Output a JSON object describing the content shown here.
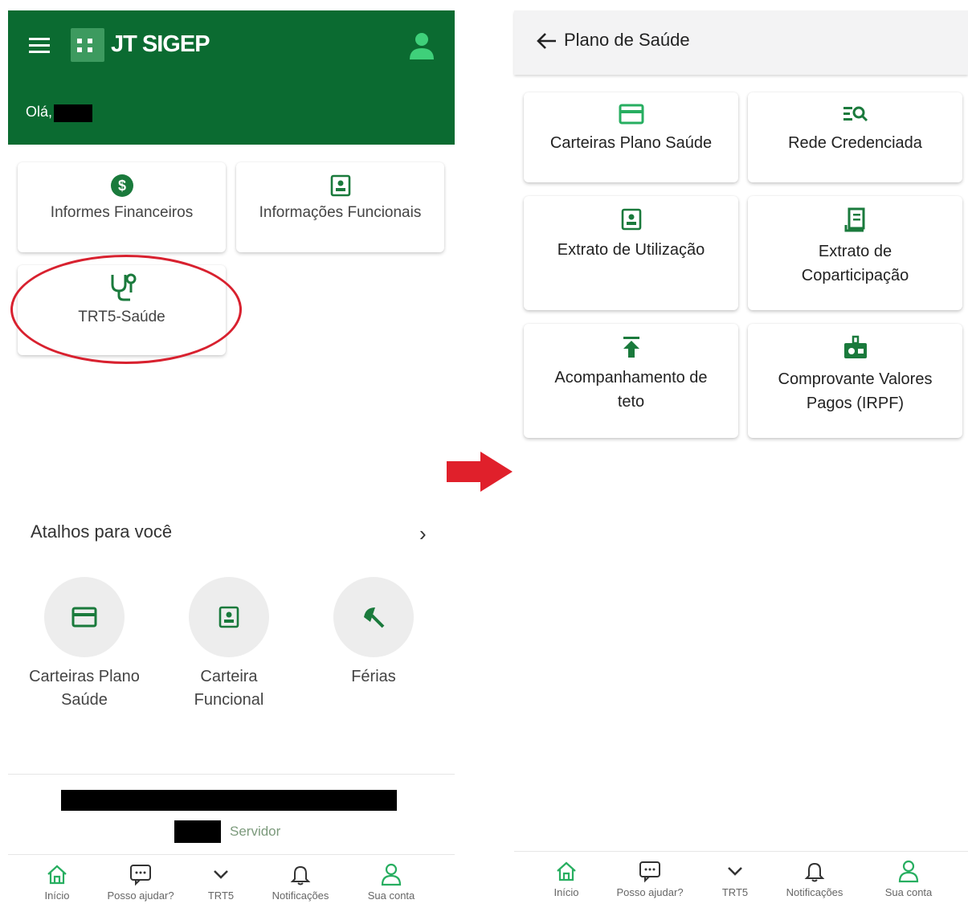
{
  "left": {
    "header": {
      "app_title": "JT SIGEP",
      "greeting": "Olá,"
    },
    "cards": [
      {
        "label": "Informes Financeiros",
        "icon": "dollar-circle-icon"
      },
      {
        "label": "Informações Funcionais",
        "icon": "id-badge-icon"
      },
      {
        "label": "TRT5-Saúde",
        "icon": "stethoscope-icon"
      }
    ],
    "shortcuts": {
      "title": "Atalhos para você",
      "items": [
        {
          "label_line1": "Carteiras Plano",
          "label_line2": "Saúde",
          "icon": "card-icon"
        },
        {
          "label_line1": "Carteira",
          "label_line2": "Funcional",
          "icon": "id-badge-icon"
        },
        {
          "label_line1": "Férias",
          "label_line2": "",
          "icon": "beach-umbrella-icon"
        }
      ]
    },
    "user_role": "Servidor",
    "bottom_nav": [
      "Início",
      "Posso ajudar?",
      "TRT5",
      "Notificações",
      "Sua conta"
    ]
  },
  "right": {
    "header": {
      "title": "Plano de Saúde"
    },
    "cards": [
      {
        "line1": "Carteiras Plano Saúde",
        "line2": "",
        "icon": "card-icon"
      },
      {
        "line1": "Rede Credenciada",
        "line2": "",
        "icon": "list-search-icon"
      },
      {
        "line1": "Extrato de Utilização",
        "line2": "",
        "icon": "id-badge-icon"
      },
      {
        "line1": "Extrato de",
        "line2": "Coparticipação",
        "icon": "receipt-icon"
      },
      {
        "line1": "Acompanhamento de",
        "line2": "teto",
        "icon": "upload-arrow-icon"
      },
      {
        "line1": "Comprovante Valores",
        "line2": "Pagos (IRPF)",
        "icon": "money-bag-icon"
      }
    ],
    "bottom_nav": [
      "Início",
      "Posso ajudar?",
      "TRT5",
      "Notificações",
      "Sua conta"
    ]
  },
  "colors": {
    "primary": "#0b6b31",
    "accent": "#27ae60",
    "highlight": "#d8212f"
  }
}
